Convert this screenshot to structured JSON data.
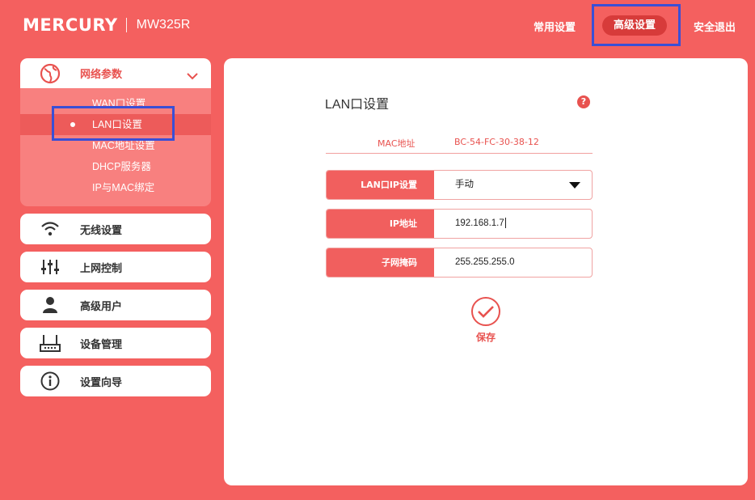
{
  "header": {
    "brand": "MERCURY",
    "model": "MW325R",
    "nav": {
      "common": "常用设置",
      "advanced": "高级设置",
      "logout": "安全退出"
    }
  },
  "sidebar": {
    "network": {
      "label": "网络参数",
      "items": [
        {
          "label": "WAN口设置"
        },
        {
          "label": "LAN口设置"
        },
        {
          "label": "MAC地址设置"
        },
        {
          "label": "DHCP服务器"
        },
        {
          "label": "IP与MAC绑定"
        }
      ]
    },
    "groups": [
      {
        "label": "无线设置",
        "icon": "wifi-icon"
      },
      {
        "label": "上网控制",
        "icon": "sliders-icon"
      },
      {
        "label": "高级用户",
        "icon": "user-icon"
      },
      {
        "label": "设备管理",
        "icon": "router-icon"
      },
      {
        "label": "设置向导",
        "icon": "info-icon"
      }
    ]
  },
  "main": {
    "title": "LAN口设置",
    "help": "?",
    "mac": {
      "label": "MAC地址",
      "value": "BC-54-FC-30-38-12"
    },
    "fields": {
      "mode": {
        "label": "LAN口IP设置",
        "value": "手动"
      },
      "ip": {
        "label": "IP地址",
        "value": "192.168.1.7"
      },
      "mask": {
        "label": "子网掩码",
        "value": "255.255.255.0"
      }
    },
    "save_label": "保存"
  },
  "colors": {
    "background": "#f4605f",
    "accent": "#e8524f",
    "highlight": "#3a4fd6"
  }
}
